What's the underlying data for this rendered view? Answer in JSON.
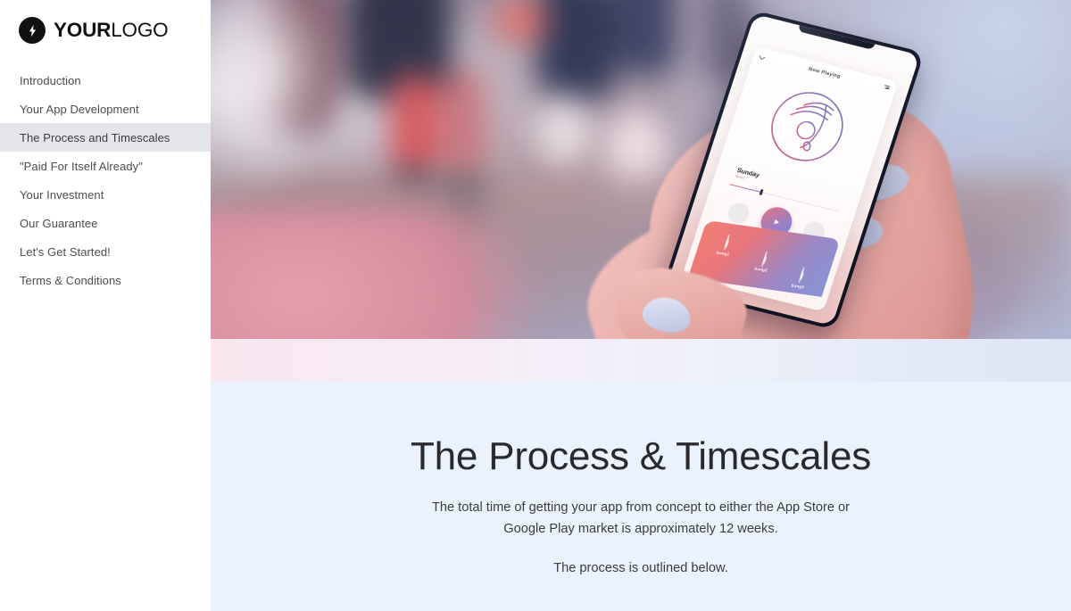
{
  "brand": {
    "icon": "lightning-bolt-icon",
    "name_strong": "YOUR",
    "name_light": "LOGO"
  },
  "sidebar": {
    "items": [
      {
        "label": "Introduction",
        "active": false
      },
      {
        "label": "Your App Development",
        "active": false
      },
      {
        "label": "The Process and Timescales",
        "active": true
      },
      {
        "label": "\"Paid For Itself Already\"",
        "active": false
      },
      {
        "label": "Your Investment",
        "active": false
      },
      {
        "label": "Our Guarantee",
        "active": false
      },
      {
        "label": "Let's Get Started!",
        "active": false
      },
      {
        "label": "Terms & Conditions",
        "active": false
      }
    ]
  },
  "hero": {
    "alt": "Hand holding a smartphone showing a music player app, blurred street background",
    "phone_app": {
      "header_title": "Now Playing",
      "collapse_icon": "chevron-down-icon",
      "menu_icon": "hamburger-menu-icon",
      "artwork_icon": "vinyl-record-icon",
      "track_title": "Sunday",
      "track_subtitle": "Music",
      "progress_percent": 28,
      "play_icon": "play-triangle-icon",
      "songs": [
        {
          "label": "Song1"
        },
        {
          "label": "Song2"
        },
        {
          "label": "Song3"
        }
      ]
    }
  },
  "content": {
    "title": "The Process & Timescales",
    "paragraph_1": "The total time of getting your app from concept to either the App Store or Google Play market is approximately 12 weeks.",
    "paragraph_2": "The process is outlined below."
  },
  "colors": {
    "sidebar_bg": "#ffffff",
    "sidebar_active_bg": "#e4e5ea",
    "nav_text": "#4c4c52",
    "content_bg": "#e9f2fd",
    "title_text": "#2a2a2e",
    "body_text": "#3b3b40",
    "band_left": "#f9e7f0",
    "band_right": "#dee5f4",
    "brand_mark": "#111111"
  }
}
